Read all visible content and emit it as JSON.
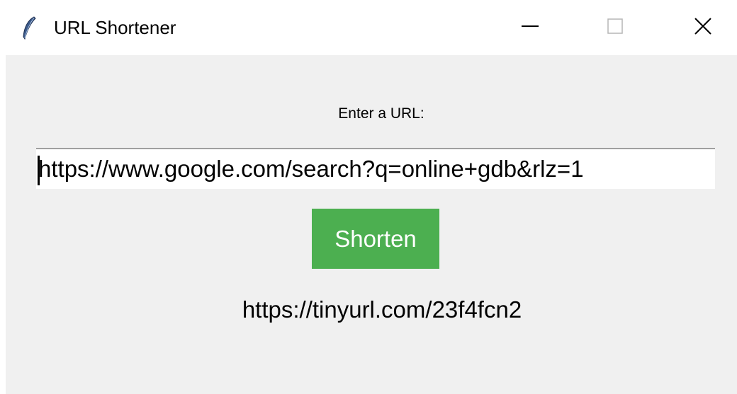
{
  "window": {
    "title": "URL Shortener",
    "icon": "feather-icon",
    "controls": {
      "minimize": "minimize-icon",
      "maximize": "maximize-icon",
      "close": "close-icon"
    }
  },
  "form": {
    "label": "Enter a URL:",
    "url_value": "https://www.google.com/search?q=online+gdb&rlz=1",
    "button_label": "Shorten",
    "result": "https://tinyurl.com/23f4fcn2"
  },
  "colors": {
    "button_bg": "#4caf50",
    "button_text": "#ffffff",
    "client_bg": "#f0f0f0",
    "titlebar_bg": "#ffffff"
  }
}
